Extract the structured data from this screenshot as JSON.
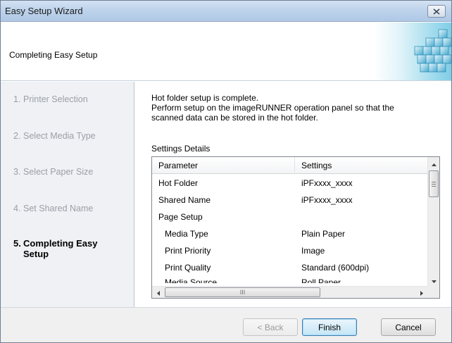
{
  "window": {
    "title": "Easy Setup Wizard"
  },
  "header": {
    "title": "Completing Easy Setup"
  },
  "steps": [
    {
      "num": "1.",
      "label": "Printer Selection",
      "active": false
    },
    {
      "num": "2.",
      "label": "Select Media Type",
      "active": false
    },
    {
      "num": "3.",
      "label": "Select Paper Size",
      "active": false
    },
    {
      "num": "4.",
      "label": "Set Shared Name",
      "active": false
    },
    {
      "num": "5.",
      "label": "Completing Easy Setup",
      "active": true
    }
  ],
  "content": {
    "message_lines": [
      "Hot folder setup is complete.",
      "Perform setup on the imageRUNNER operation panel so that the",
      "scanned data can be stored in the hot folder."
    ],
    "settings_label": "Settings Details"
  },
  "table": {
    "headers": [
      "Parameter",
      "Settings"
    ],
    "rows": [
      {
        "parameter": "Hot Folder",
        "value": "iPFxxxx_xxxx",
        "indent": false
      },
      {
        "parameter": "Shared Name",
        "value": "iPFxxxx_xxxx",
        "indent": false
      },
      {
        "parameter": "Page Setup",
        "value": "",
        "indent": false
      },
      {
        "parameter": "Media Type",
        "value": "Plain Paper",
        "indent": true
      },
      {
        "parameter": "Print Priority",
        "value": "Image",
        "indent": true
      },
      {
        "parameter": "Print Quality",
        "value": "Standard (600dpi)",
        "indent": true
      },
      {
        "parameter": "Media Source",
        "value": "Roll Paper",
        "indent": true
      }
    ]
  },
  "scrollbars": {
    "h_grip": "III"
  },
  "buttons": {
    "back": "< Back",
    "finish": "Finish",
    "cancel": "Cancel"
  },
  "icons": {
    "close": "close-icon",
    "scroll_up": "arrow-up-icon",
    "scroll_down": "arrow-down-icon",
    "scroll_left": "arrow-left-icon",
    "scroll_right": "arrow-right-icon",
    "header_graphic": "printer-blocks-graphic"
  },
  "colors": {
    "title_bar": "#bed3eb",
    "sidebar_bg": "#eff1f4",
    "footer_bg": "#f0f0f0",
    "primary_button_border": "#3c7fb1"
  }
}
